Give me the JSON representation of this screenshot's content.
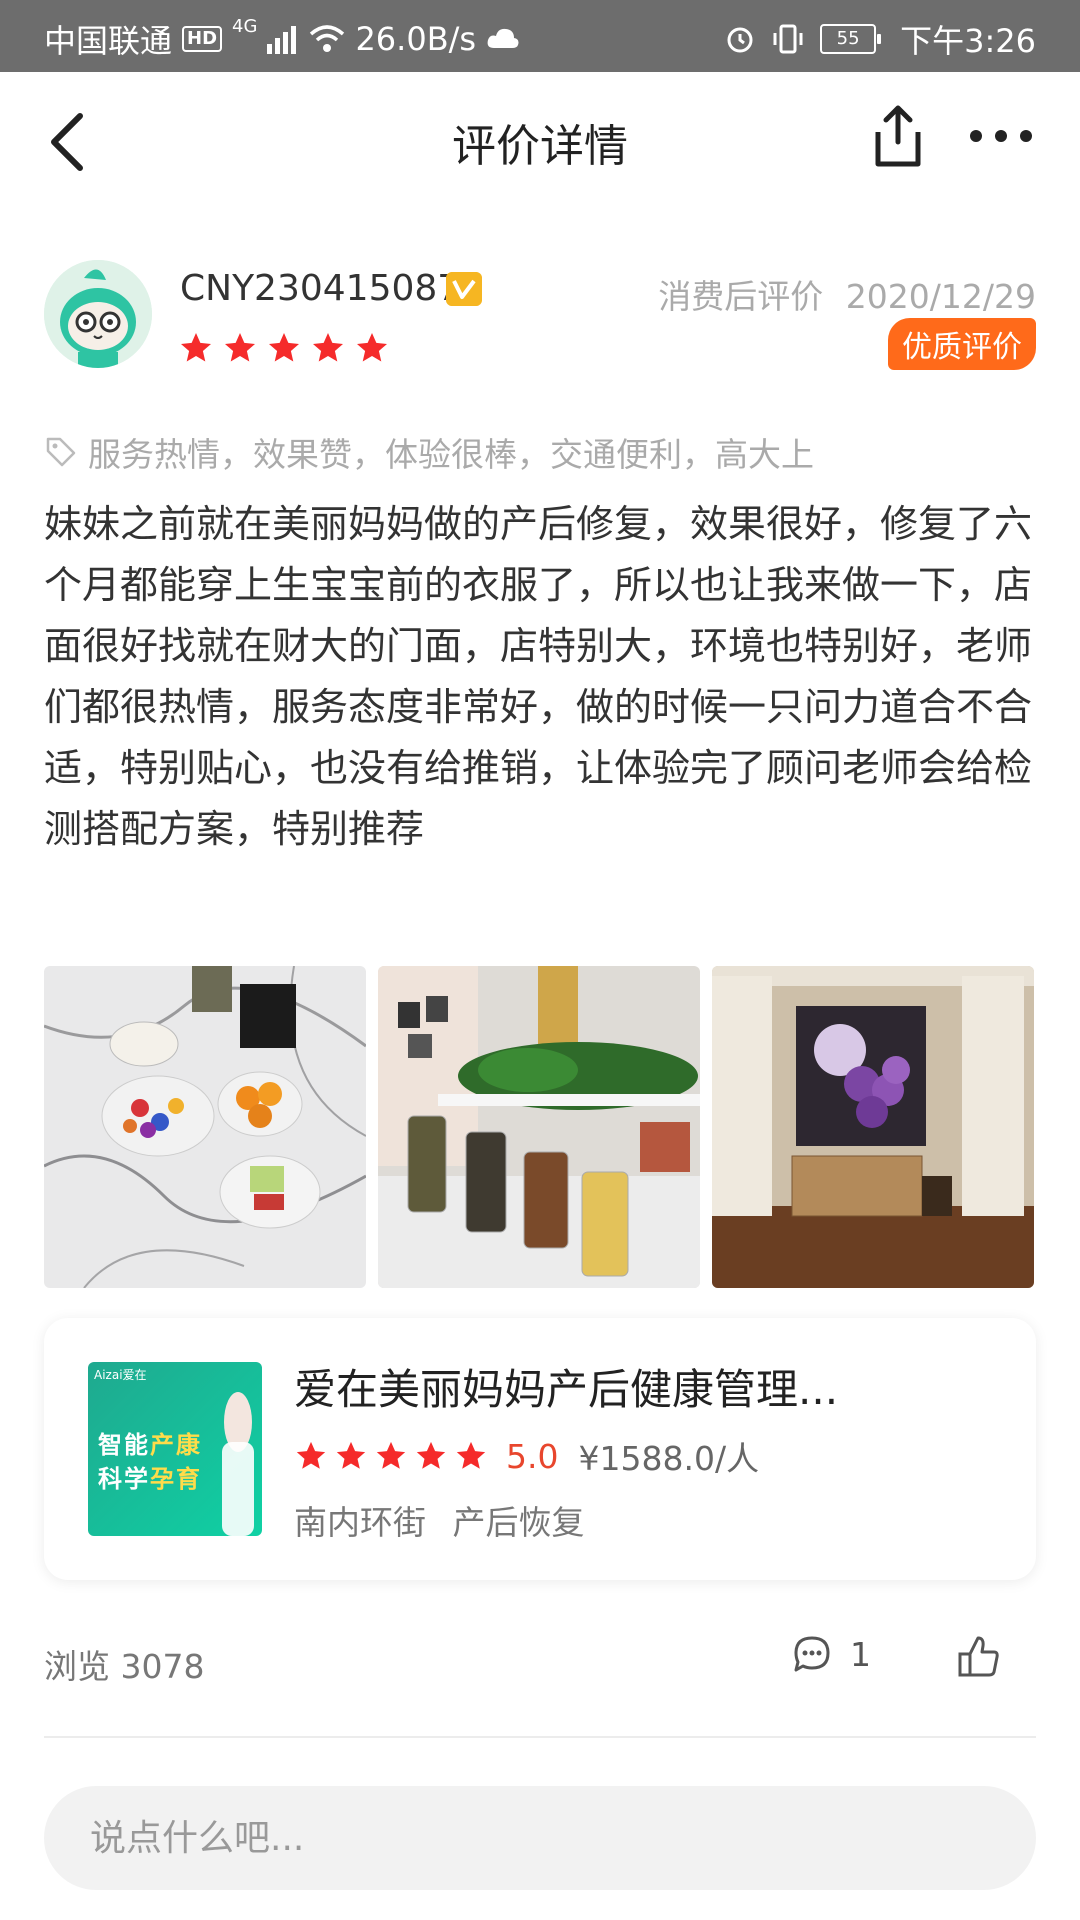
{
  "status_bar": {
    "carrier": "中国联通",
    "hd": "HD",
    "network": "4G",
    "speed": "26.0B/s",
    "battery": "55",
    "time": "下午3:26"
  },
  "header": {
    "title": "评价详情",
    "back_icon": "chevron-left-icon",
    "share_icon": "share-icon",
    "more_icon": "more-icon"
  },
  "review": {
    "username": "CNY230415087",
    "user_level_badge": "V",
    "rating_stars": 5,
    "consume_label": "消费后评价",
    "date": "2020/12/29",
    "quality_badge": "优质评价",
    "tags": "服务热情，效果赞，体验很棒，交通便利，高大上",
    "content": "妹妹之前就在美丽妈妈做的产后修复，效果很好，修复了六个月都能穿上生宝宝前的衣服了，所以也让我来做一下，店面很好找就在财大的门面，店特别大，环境也特别好，老师们都很热情，服务态度非常好，做的时候一只问力道合不合适，特别贴心，也没有给推销，让体验完了顾问老师会给检测搭配方案，特别推荐"
  },
  "shop": {
    "thumb_brand": "Aizai爱在",
    "thumb_line1_a": "智能",
    "thumb_line1_b": "产康",
    "thumb_line2_a": "科学",
    "thumb_line2_b": "孕育",
    "name": "爱在美丽妈妈产后健康管理...",
    "stars": 5,
    "score": "5.0",
    "price": "¥1588.0/人",
    "location": "南内环街",
    "category": "产后恢复"
  },
  "stats": {
    "views_label": "浏览",
    "views": "3078",
    "comments": "1"
  },
  "comment_input": {
    "placeholder": "说点什么吧..."
  },
  "colors": {
    "star_red": "#f52b2b",
    "quality_orange": "#ff6a1a",
    "score_red": "#e8462d",
    "status_bar_bg": "#6d6d6d"
  }
}
